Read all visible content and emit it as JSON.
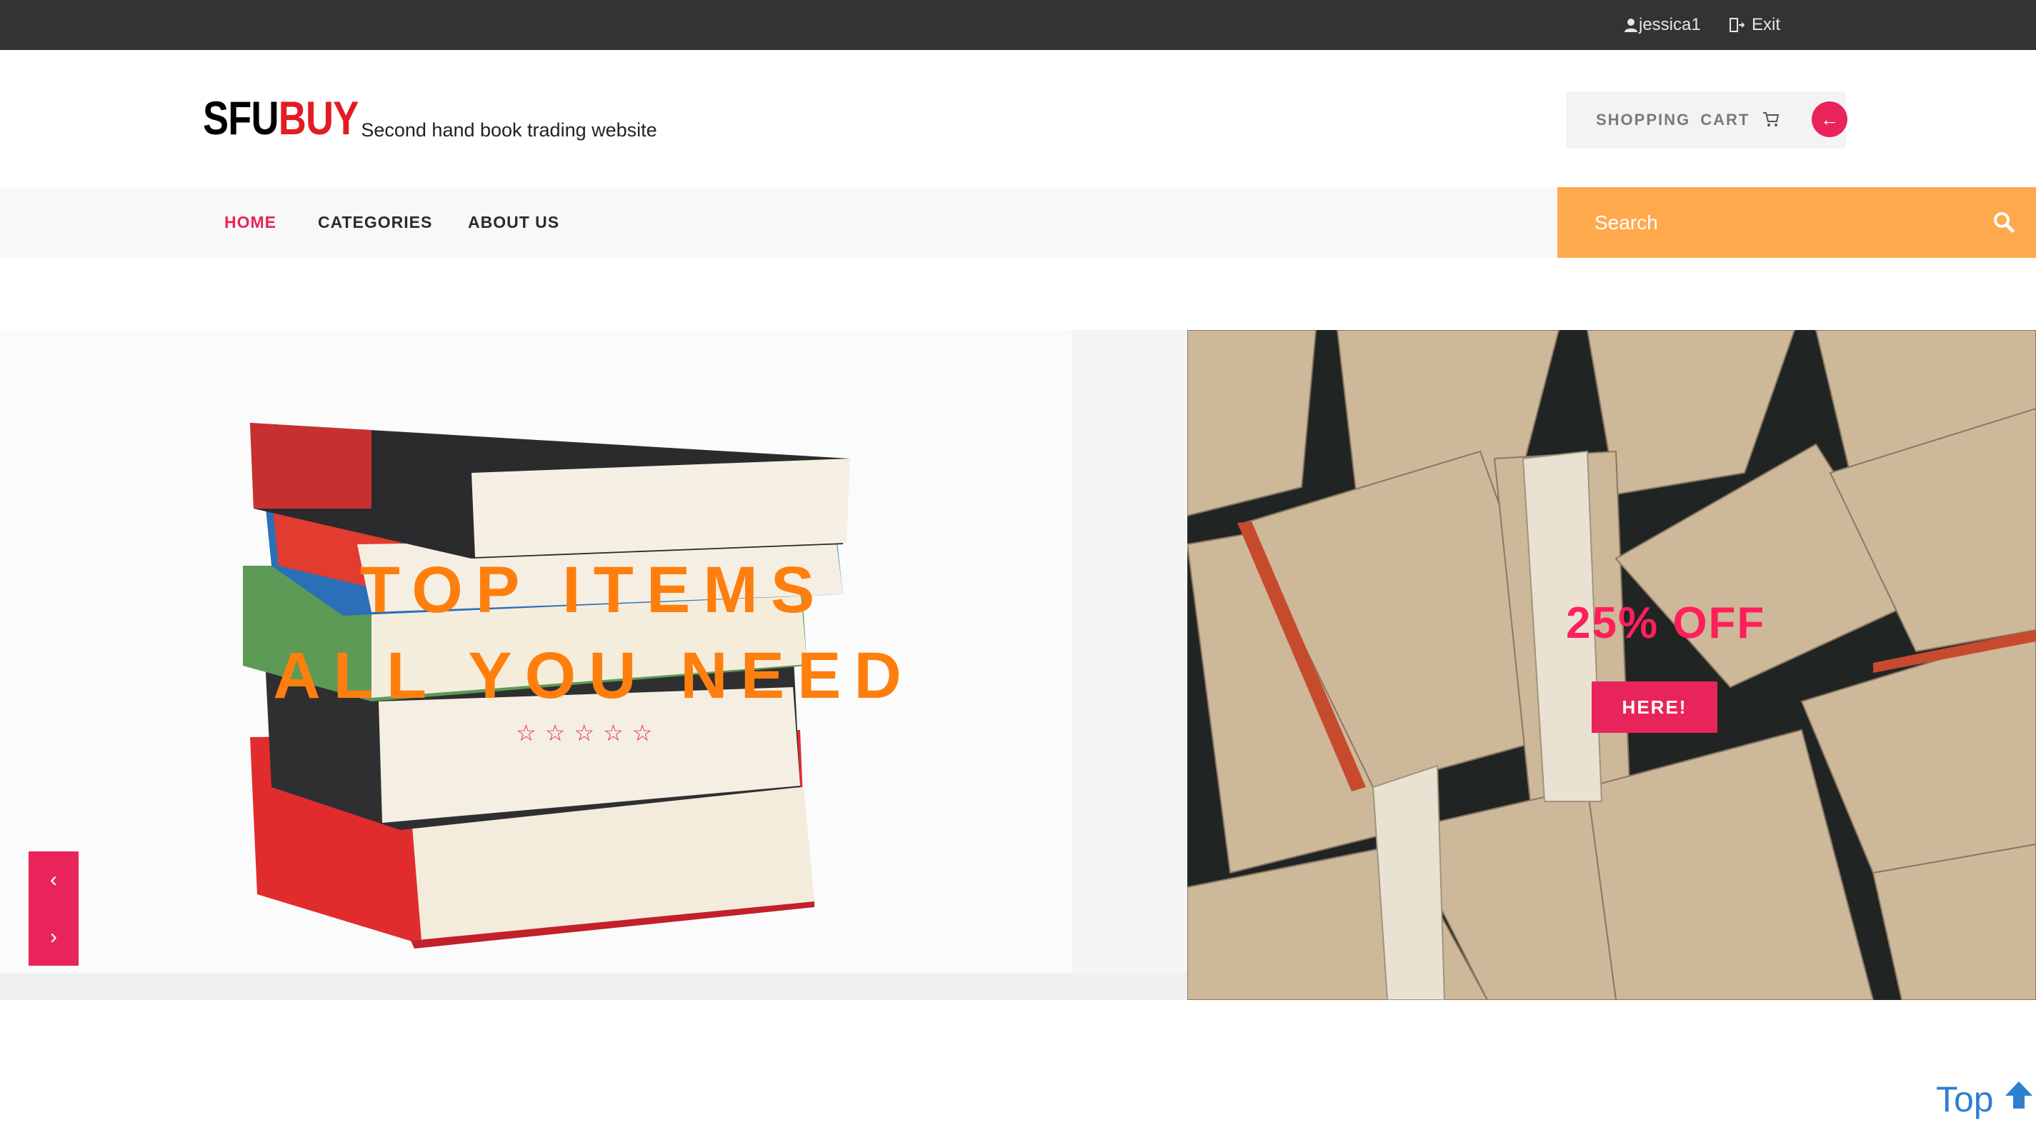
{
  "topbar": {
    "username": "jessica1",
    "exit_label": "Exit"
  },
  "header": {
    "logo_part1": "SFU",
    "logo_part2": "BUY",
    "tagline": "Second hand book trading website",
    "cart_label": "SHOPPING CART",
    "back_symbol": "←"
  },
  "nav": {
    "items": [
      {
        "label": "HOME",
        "active": true
      },
      {
        "label": "CATEGORIES",
        "active": false
      },
      {
        "label": "ABOUT US",
        "active": false
      }
    ]
  },
  "search": {
    "placeholder": "Search"
  },
  "hero": {
    "title_line1": "TOP ITEMS",
    "title_line2": "ALL YOU NEED",
    "rating_stars": 5,
    "star_symbol": "☆",
    "prev_symbol": "‹",
    "next_symbol": "›"
  },
  "promo": {
    "title": "25% OFF",
    "button_label": "HERE!"
  },
  "scroll_top": {
    "label": "Top"
  },
  "colors": {
    "accent": "#e8245a",
    "orange": "#ffa94d",
    "hero_text": "#ff7f0e",
    "topbar": "#333333",
    "link": "#2f7fd1"
  }
}
